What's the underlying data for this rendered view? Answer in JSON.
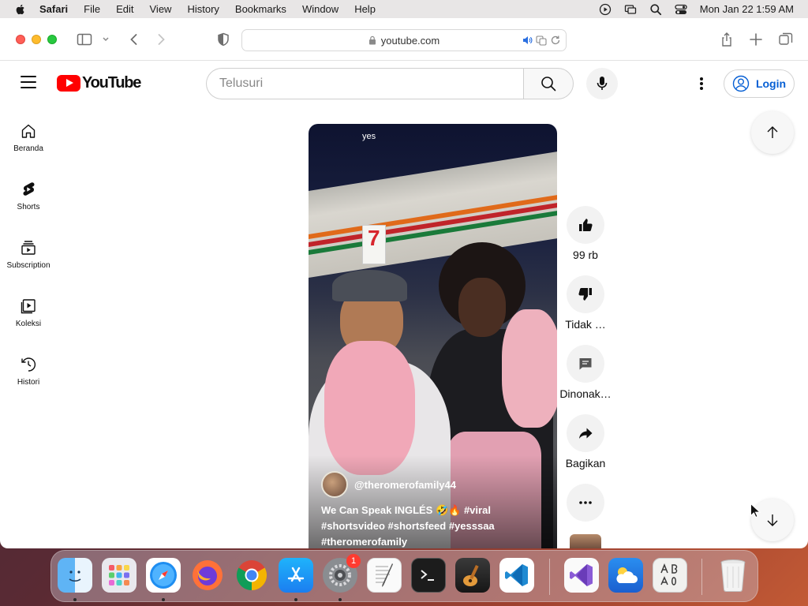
{
  "menubar": {
    "app_name": "Safari",
    "items": [
      "File",
      "Edit",
      "View",
      "History",
      "Bookmarks",
      "Window",
      "Help"
    ],
    "datetime": "Mon Jan 22  1:59 AM"
  },
  "browser": {
    "url": "youtube.com"
  },
  "youtube": {
    "logo_text": "YouTube",
    "search_placeholder": "Telusuri",
    "login_label": "Login",
    "nav": [
      {
        "label": "Beranda",
        "icon": "home-icon"
      },
      {
        "label": "Shorts",
        "icon": "shorts-icon"
      },
      {
        "label": "Subscription",
        "icon": "subscriptions-icon"
      },
      {
        "label": "Koleksi",
        "icon": "library-icon"
      },
      {
        "label": "Histori",
        "icon": "history-icon"
      }
    ],
    "short": {
      "overlay_text": "yes",
      "channel": "@theromerofamily44",
      "caption": "We Can Speak INGLÉS 🤣🔥 #viral #shortsvideo #shortsfeed #yesssaa #theromerofamily"
    },
    "actions": {
      "like_count": "99 rb",
      "dislike_label": "Tidak …",
      "comments_label": "Dinonak…",
      "share_label": "Bagikan"
    }
  },
  "dock": {
    "settings_badge": "1",
    "apps": [
      "Finder",
      "Launchpad",
      "Safari",
      "Firefox",
      "Chrome",
      "App Store",
      "System Settings",
      "TextEdit",
      "Terminal",
      "GarageBand",
      "VS Code",
      "Visual Studio",
      "Weather",
      "Font Book",
      "Trash"
    ]
  }
}
